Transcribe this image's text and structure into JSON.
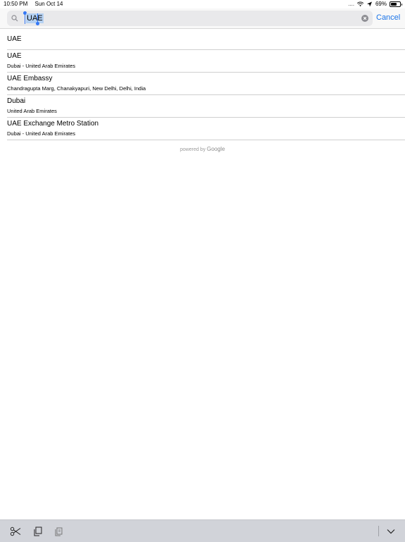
{
  "status_bar": {
    "time": "10:50 PM",
    "date": "Sun Oct 14",
    "signal": "....",
    "battery_percent": "69%",
    "battery_level": 0.69
  },
  "search": {
    "query": "UAE",
    "cancel_label": "Cancel"
  },
  "results": [
    {
      "title": "UAE",
      "subtitle": ""
    },
    {
      "title": "UAE",
      "subtitle": "Dubai - United Arab Emirates"
    },
    {
      "title": "UAE Embassy",
      "subtitle": "Chandragupta Marg, Chanakyapuri, New Delhi, Delhi, India"
    },
    {
      "title": "Dubai",
      "subtitle": "United Arab Emirates"
    },
    {
      "title": "UAE Exchange Metro Station",
      "subtitle": "Dubai - United Arab Emirates"
    }
  ],
  "attribution": {
    "prefix": "powered by",
    "brand": "Google"
  },
  "toolbar": {
    "icons": [
      "scissors-icon",
      "copy-icon",
      "paste-icon",
      "chevron-down-icon"
    ]
  },
  "colors": {
    "accent": "#1a73e8",
    "selection": "#b5d1f2",
    "toolbar_bg": "#d1d3d9"
  }
}
